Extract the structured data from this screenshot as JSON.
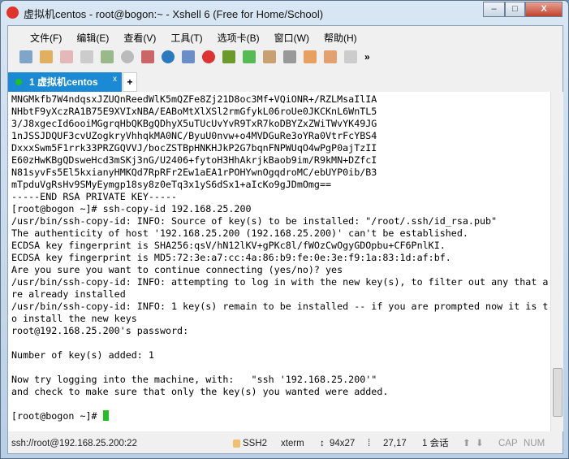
{
  "window": {
    "title": "虚拟机centos - root@bogon:~ - Xshell 6 (Free for Home/School)",
    "minimize": "–",
    "maximize": "□",
    "close": "X"
  },
  "menu": [
    "文件(F)",
    "编辑(E)",
    "查看(V)",
    "工具(T)",
    "选项卡(B)",
    "窗口(W)",
    "帮助(H)"
  ],
  "tab": {
    "label": "1 虚拟机centos",
    "close": "x",
    "add": "+"
  },
  "terminal": {
    "lines": [
      "MNGMkfb7W4ndqsxJZUQnReedWlK5mQZFe8Zj21D8oc3Mf+VQiONR+/RZLMsaIlIA",
      "NHbtF9yXczRA1B75E9XVIxNBA/EABoMtXlXSl2rmGfykL06roUe0JKCKnL6WnTL5",
      "3/J8xgecId6ooiMGgrqHbQKBgQDhyX5uTUcUvYvR9TxR7koDBYZxZWiTWvYK49JG",
      "1nJSSJDQUF3cvUZogkryVhhqkMA0NC/ByuU0nvw+o4MVDGuRe3oYRa0VtrFcYBS4",
      "DxxxSwm5F1rrk33PRZGQVVJ/bocZSTBpHNKHJkP2G7bqnFNPWUqO4wPgP0ajTzII",
      "E60zHwKBgQDsweHcd3mSKj3nG/U2406+fytoH3HhAkrjkBaob9im/R9kMN+DZfcI",
      "N81syvFs5El5kxianyHMKQd7RpRFr2Ew1aEA1rPOHYwnOgqdroMC/ebUYP0ib/B3",
      "mTpduVgRsHv9SMyEymgp18sy8z0eTq3x1yS6dSx1+aIcKo9gJDmOmg==",
      "-----END RSA PRIVATE KEY-----",
      "[root@bogon ~]# ssh-copy-id 192.168.25.200",
      "/usr/bin/ssh-copy-id: INFO: Source of key(s) to be installed: \"/root/.ssh/id_rsa.pub\"",
      "The authenticity of host '192.168.25.200 (192.168.25.200)' can't be established.",
      "ECDSA key fingerprint is SHA256:qsV/hN12lKV+gPKc8l/fWOzCwOgyGDOpbu+CF6PnlKI.",
      "ECDSA key fingerprint is MD5:72:3e:a7:cc:4a:86:b9:fe:0e:3e:f9:1a:83:1d:af:bf.",
      "Are you sure you want to continue connecting (yes/no)? yes",
      "/usr/bin/ssh-copy-id: INFO: attempting to log in with the new key(s), to filter out any that a",
      "re already installed",
      "/usr/bin/ssh-copy-id: INFO: 1 key(s) remain to be installed -- if you are prompted now it is t",
      "o install the new keys",
      "root@192.168.25.200's password: ",
      "",
      "Number of key(s) added: 1",
      "",
      "Now try logging into the machine, with:   \"ssh '192.168.25.200'\"",
      "and check to make sure that only the key(s) you wanted were added.",
      "",
      "[root@bogon ~]# "
    ]
  },
  "status": {
    "connection": "ssh://root@192.168.25.200:22",
    "protocol": "SSH2",
    "term": "xterm",
    "size": "94x27",
    "cursor": "27,17",
    "sessions": "1 会话",
    "cap": "CAP",
    "num": "NUM"
  }
}
